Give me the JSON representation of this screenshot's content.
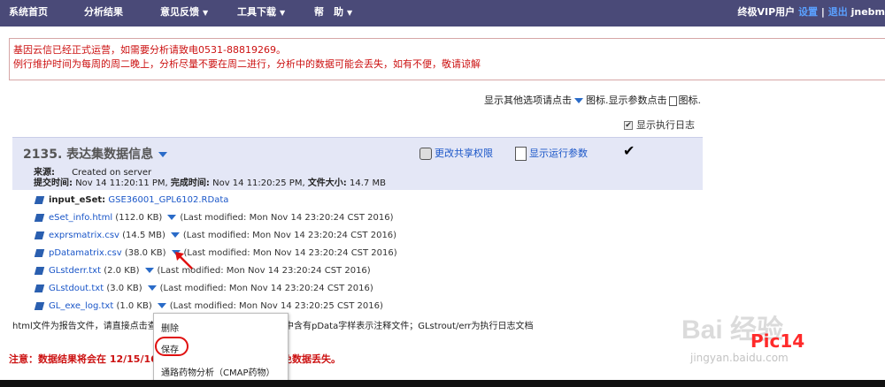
{
  "nav": {
    "items": [
      "系统首页",
      "分析结果",
      "意见反馈",
      "工具下载",
      "帮　助"
    ],
    "user_prefix": "终极VIP用户",
    "settings_link": "设置",
    "sep": "|",
    "logout_link": "退出",
    "username": "jnebm"
  },
  "notice": {
    "line1": "基因云信已经正式运营，如需要分析请致电0531-88819269。",
    "line2": "例行维护时间为每周的周二晚上，分析尽量不要在周二进行，分析中的数据可能会丢失，如有不便，敬请谅解"
  },
  "options": {
    "show_options_pre": "显示其他选项请点击",
    "icon_label": "图标.",
    "show_params_pre": "显示参数点击",
    "icon_label2": "图标."
  },
  "log_checkbox": {
    "label": "显示执行日志",
    "checked": true
  },
  "job": {
    "title": "2135. 表达集数据信息",
    "share_label": "更改共享权限",
    "params_label": "显示运行参数",
    "check_mark": "✔",
    "source_label": "来源:",
    "source_value": "Created on server",
    "submit_label": "提交时间:",
    "submit_value": "Nov 14 11:20:11 PM,",
    "finish_label": "完成时间:",
    "finish_value": "Nov 14 11:20:25 PM,",
    "size_label": "文件大小:",
    "size_value": "14.7 MB"
  },
  "files": {
    "input_label": "input_eSet:",
    "input_file": "GSE36001_GPL6102.RData",
    "rows": [
      {
        "name": "eSet_info.html",
        "size": "(112.0 KB)",
        "modified": "(Last modified: Mon Nov 14 23:20:24 CST 2016)"
      },
      {
        "name": "exprsmatrix.csv",
        "size": "(14.5 MB)",
        "modified": "(Last modified: Mon Nov 14 23:20:24 CST 2016)"
      },
      {
        "name": "pDatamatrix.csv",
        "size": "(38.0 KB)",
        "modified": "(Last modified: Mon Nov 14 23:20:24 CST 2016)"
      },
      {
        "name": "GLstderr.txt",
        "size": "(2.0 KB)",
        "modified": "(Last modified: Mon Nov 14 23:20:24 CST 2016)"
      },
      {
        "name": "GLstdout.txt",
        "size": "(3.0 KB)",
        "modified": "(Last modified: Mon Nov 14 23:20:24 CST 2016)"
      },
      {
        "name": "GL_exe_log.txt",
        "size": "(1.0 KB)",
        "modified": "(Last modified: Mon Nov 14 23:20:25 CST 2016)"
      }
    ]
  },
  "description": {
    "left": "html文件为报告文件，请直接点击查",
    "right": "件中含有pData字样表示注释文件；GLstrout/err为执行日志文档"
  },
  "warning": {
    "left": "注意：数据结果将会在 12/15/16",
    "right": "避免数据丢失。"
  },
  "context_menu": {
    "items": [
      "删除",
      "保存",
      "通路药物分析（CMAP药物）"
    ]
  },
  "watermark": {
    "brand": "Bai 经验",
    "url": "jingyan.baidu.com",
    "pic_label": "Pic14"
  },
  "colors": {
    "nav_bg": "#4a4a78",
    "panel_bg": "#e4e7f6",
    "link": "#1a56c8",
    "alert": "#cc1111"
  }
}
